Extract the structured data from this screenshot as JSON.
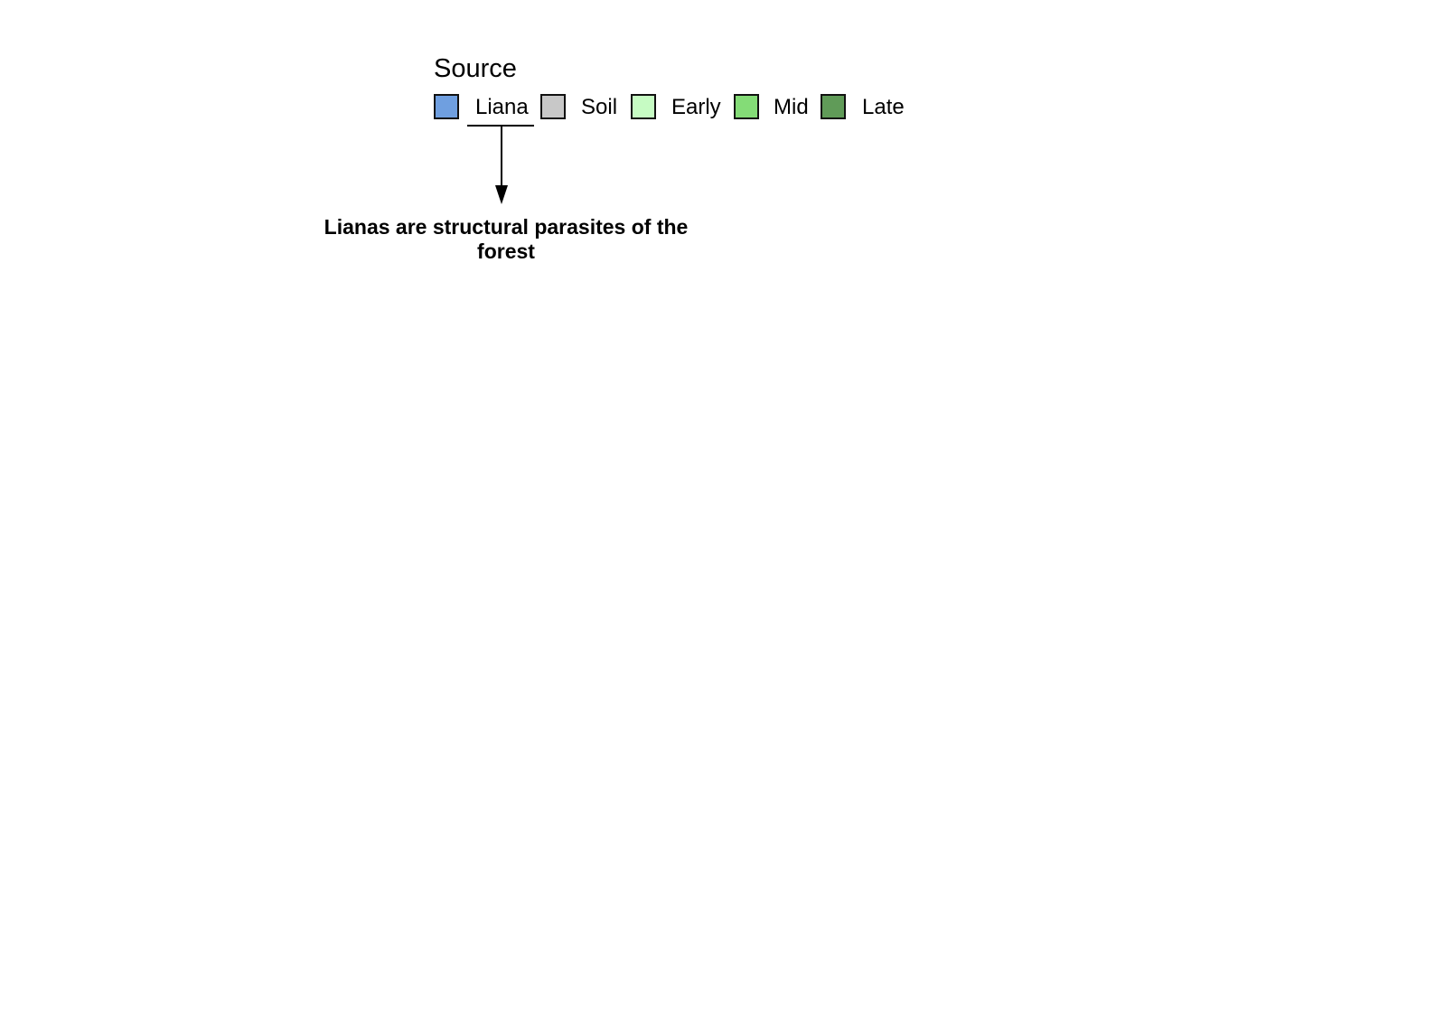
{
  "legend": {
    "title": "Source",
    "items": [
      {
        "label": "Liana",
        "color": "#6f9fe0"
      },
      {
        "label": "Soil",
        "color": "#c8c8c8"
      },
      {
        "label": "Early",
        "color": "#c6fbc3"
      },
      {
        "label": "Mid",
        "color": "#84dc77"
      },
      {
        "label": "Late",
        "color": "#609b58"
      }
    ]
  },
  "annotation": {
    "text": "Lianas are structural parasites of the forest"
  }
}
